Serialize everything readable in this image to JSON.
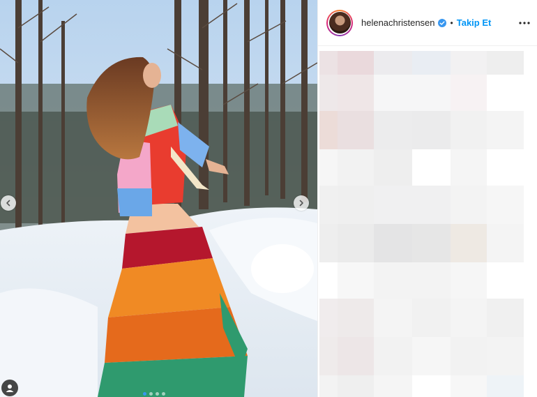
{
  "post": {
    "username": "helenachristensen",
    "separator": "•",
    "follow_label": "Takip Et",
    "verified_icon": "verified-badge-icon",
    "more_icon": "more-options-icon"
  },
  "media": {
    "prev_icon": "chevron-left-icon",
    "next_icon": "chevron-right-icon",
    "tag_icon": "user-tag-icon",
    "carousel_count": 4,
    "carousel_active": 1
  },
  "colors": {
    "accent": "#0095f6",
    "active_dot": "#3897f0",
    "text": "#262626"
  }
}
